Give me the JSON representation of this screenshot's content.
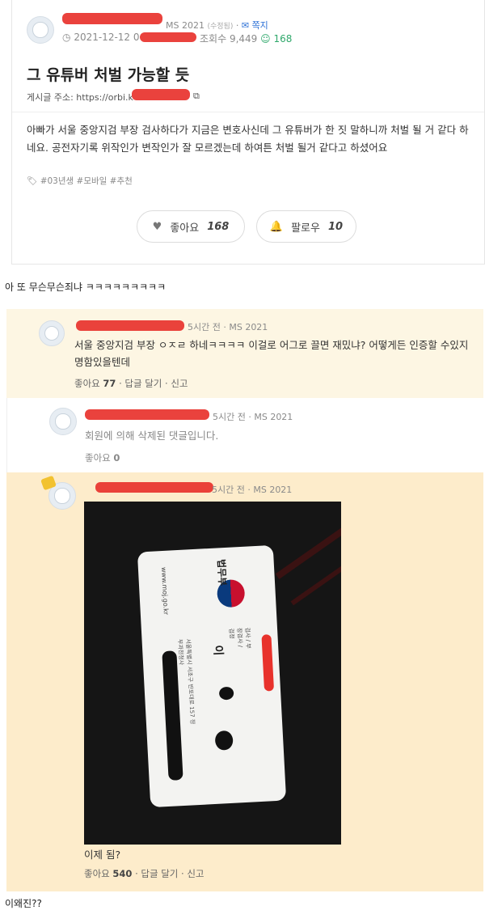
{
  "post": {
    "meta_author_suffix": "MS 2021",
    "meta_edited": "(수정됨)",
    "meta_message": "쪽지",
    "date": "2021-12-12 0",
    "views_label": "조회수",
    "views": "9,449",
    "comment_count": "168",
    "title": "그 유튜버 처벌 가능할 듯",
    "url_label": "게시글 주소: https://orbi.k",
    "body": "아빠가 서울 중앙지검 부장 검사하다가 지금은 변호사신데 그 유튜버가 한 짓 말하니까 처벌 될 거 같다 하네요. 공전자기록 위작인가 변작인가 잘 모르겠는데 하여튼 처벌 될거 같다고 하셨어요",
    "tags": [
      "#03년생",
      "#모바일",
      "#추천"
    ],
    "like_label": "좋아요",
    "like_count": "168",
    "follow_label": "팔로우",
    "follow_count": "10"
  },
  "caption_1": "아 또 무슨무슨죄냐 ㅋㅋㅋㅋㅋㅋㅋㅋㅋ",
  "comments": [
    {
      "meta": "5시간 전 · MS 2021",
      "text": "서울 중앙지검 부장 ㅇㅈㄹ 하네ㅋㅋㅋㅋ 이걸로 어그로 끌면 재밌냐? 어떻게든 인증할 수있지 명함있을텐데",
      "like_label": "좋아요",
      "like_count": "77",
      "reply": "답글 달기",
      "report": "신고"
    },
    {
      "meta": "5시간 전 · MS 2021",
      "text": "회원에 의해 삭제된 댓글입니다.",
      "like_label": "좋아요",
      "like_count": "0"
    },
    {
      "meta": "5시간 전 · MS 2021",
      "text": "이제 됨?",
      "like_label": "좋아요",
      "like_count": "540",
      "reply": "답글 달기",
      "report": "신고",
      "card_text": {
        "org": "법무부",
        "name": "이",
        "site": "www.moj.go.kr",
        "title": "검사 / 부장검사 / 검정",
        "address": "서울특별시 서초구 반포대로 157 정부과천청사"
      }
    }
  ],
  "caption_2": "이왜진??",
  "colors": {
    "accent_green": "#2fa86b",
    "accent_blue": "#2a6fd6",
    "highlight_bg": "#fdf6e3",
    "highlight_bg_strong": "#fdeccb",
    "redaction": "#e8322c"
  }
}
